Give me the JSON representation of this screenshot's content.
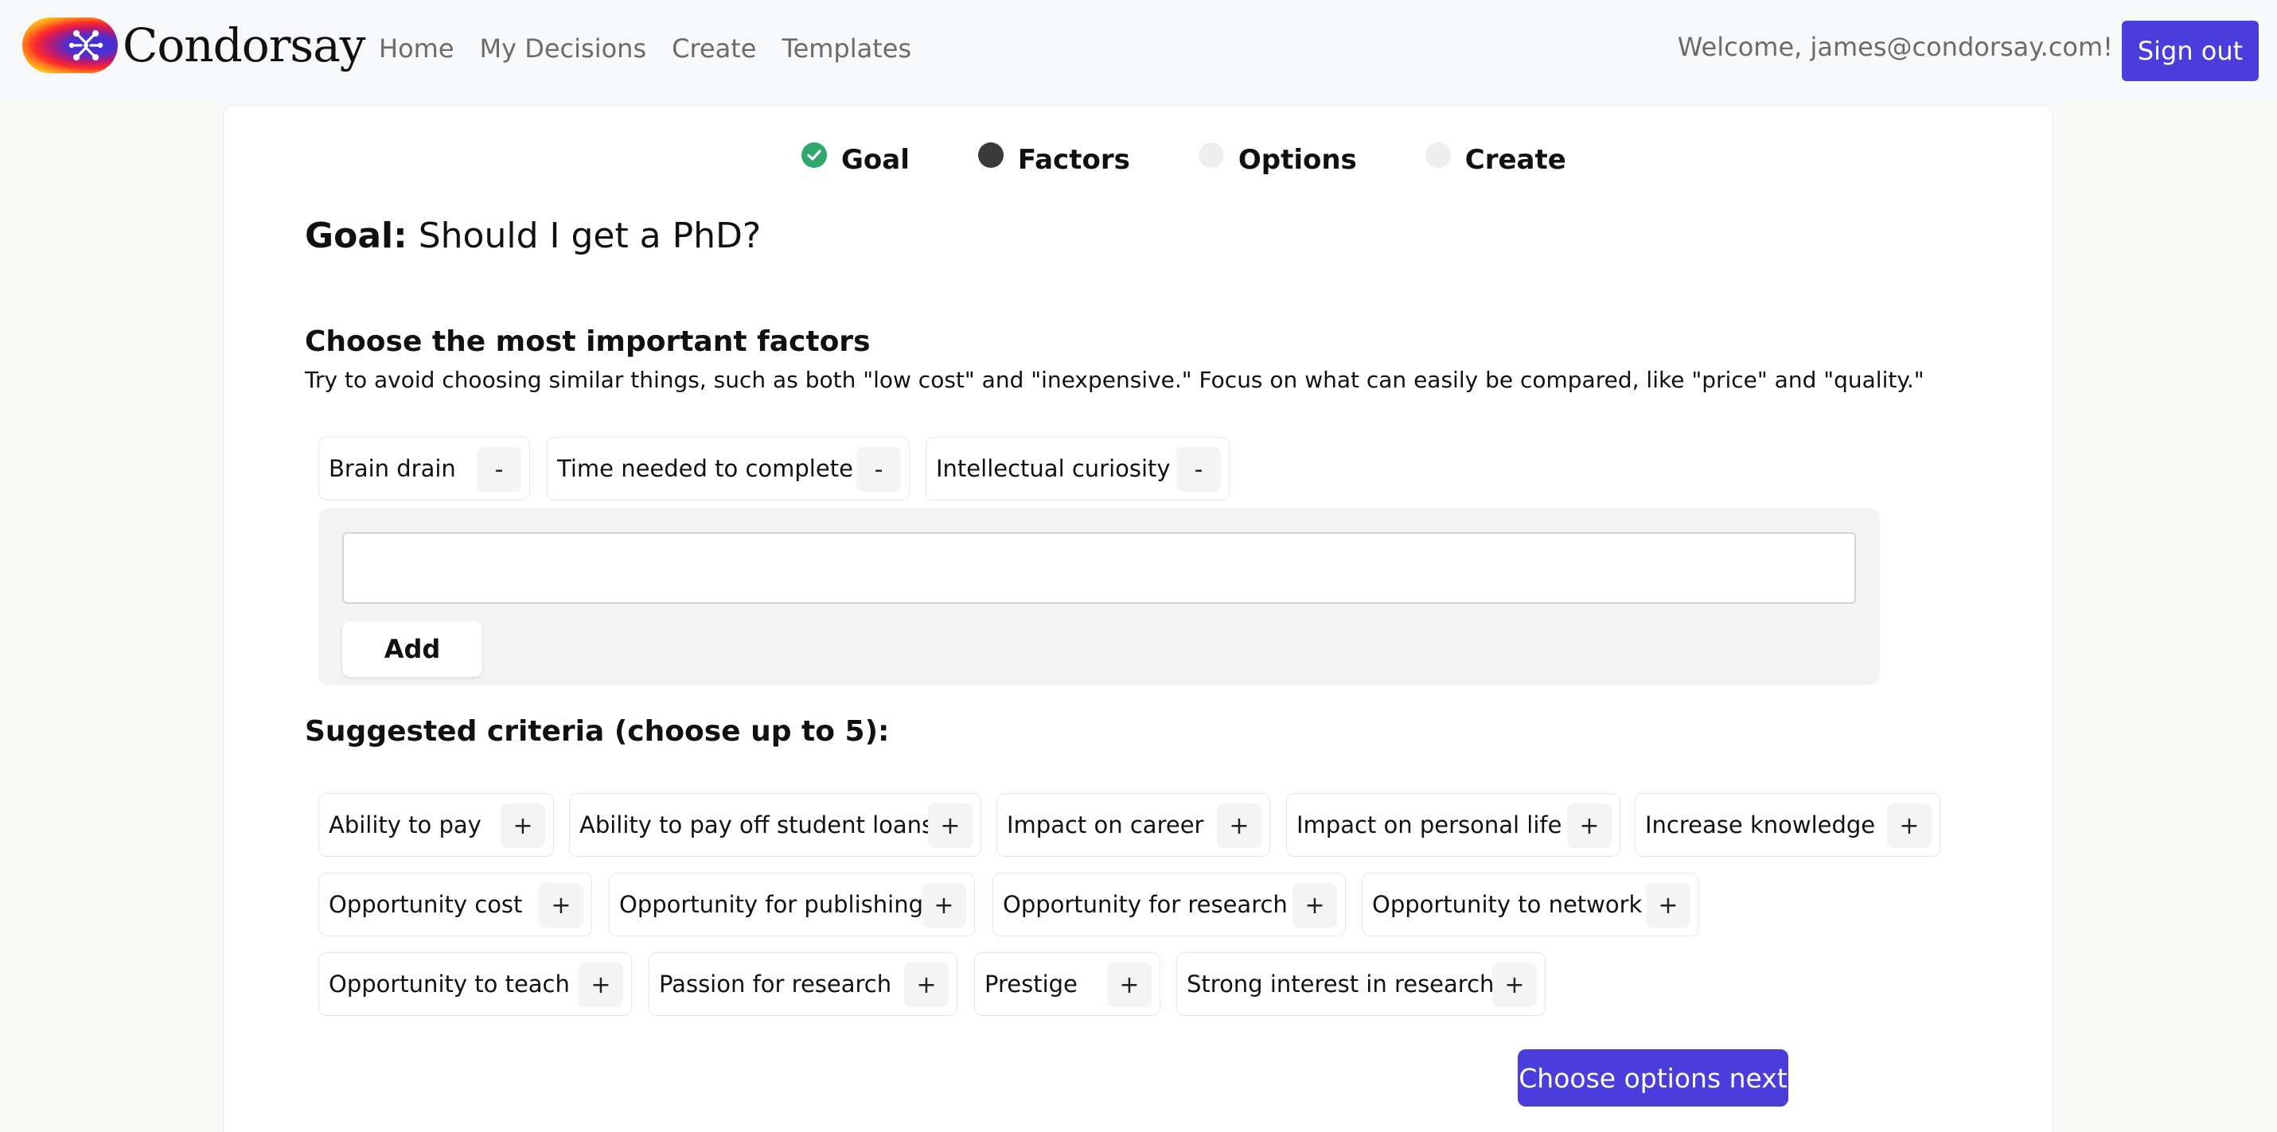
{
  "brand": {
    "name": "Condorsay"
  },
  "nav": {
    "links": [
      "Home",
      "My Decisions",
      "Create",
      "Templates"
    ],
    "welcome": "Welcome, james@condorsay.com!",
    "signout": "Sign out"
  },
  "steps": [
    {
      "label": "Goal",
      "state": "done"
    },
    {
      "label": "Factors",
      "state": "current"
    },
    {
      "label": "Options",
      "state": "todo"
    },
    {
      "label": "Create",
      "state": "todo"
    }
  ],
  "goal": {
    "prefix": "Goal:",
    "text": "Should I get a PhD?"
  },
  "factors": {
    "title": "Choose the most important factors",
    "hint": "Try to avoid choosing similar things, such as both \"low cost\" and \"inexpensive.\" Focus on what can easily be compared, like \"price\" and \"quality.\"",
    "selected": [
      "Brain drain",
      "Time needed to complete",
      "Intellectual curiosity"
    ],
    "remove_symbol": "-",
    "input_value": "",
    "add_label": "Add"
  },
  "suggested": {
    "title": "Suggested criteria (choose up to 5):",
    "add_symbol": "+",
    "items": [
      "Ability to pay",
      "Ability to pay off student loans",
      "Impact on career",
      "Impact on personal life",
      "Increase knowledge",
      "Opportunity cost",
      "Opportunity for publishing",
      "Opportunity for research",
      "Opportunity to network",
      "Opportunity to teach",
      "Passion for research",
      "Prestige",
      "Strong interest in research"
    ]
  },
  "next_button": "Choose options next",
  "colors": {
    "accent": "#4a3ddb",
    "done": "#2ea86b",
    "current": "#3a3a3a",
    "todo": "#eeeeee"
  }
}
